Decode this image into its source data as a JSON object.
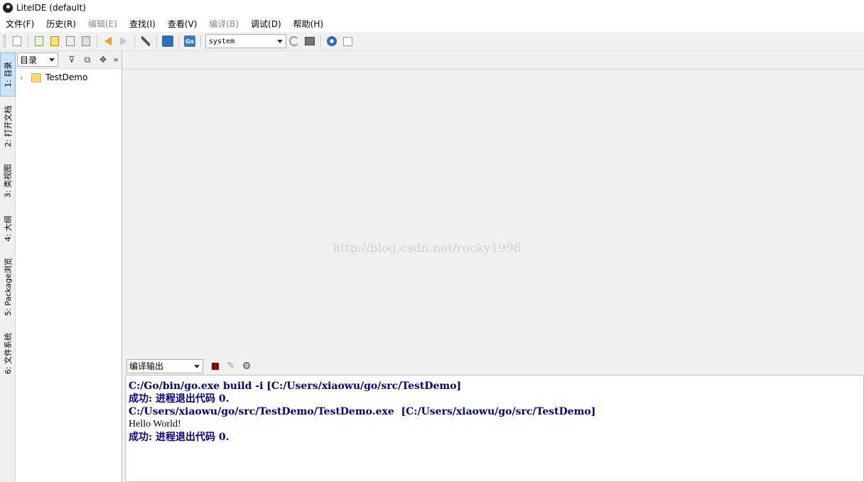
{
  "window": {
    "title": "LiteIDE (default)"
  },
  "menu": [
    {
      "label": "文件(F)",
      "enabled": true
    },
    {
      "label": "历史(R)",
      "enabled": true
    },
    {
      "label": "编辑(E)",
      "enabled": false
    },
    {
      "label": "查找(I)",
      "enabled": true
    },
    {
      "label": "查看(V)",
      "enabled": true
    },
    {
      "label": "编译(B)",
      "enabled": false
    },
    {
      "label": "调试(D)",
      "enabled": true
    },
    {
      "label": "帮助(H)",
      "enabled": true
    }
  ],
  "toolbar": {
    "env_value": "system",
    "icons": [
      "new-file-icon",
      "open-file-icon",
      "save-icon",
      "save-as-icon",
      "save-all-icon",
      "back-arrow-icon",
      "forward-arrow-icon",
      "tools-icon",
      "home-icon",
      "go-icon",
      "refresh-icon",
      "environment-icon",
      "settings-icon",
      "checkbox-icon"
    ]
  },
  "side_tabs": [
    {
      "label": "1: 目录",
      "active": true
    },
    {
      "label": "2: 打开文档",
      "active": false
    },
    {
      "label": "3: 类视图",
      "active": false
    },
    {
      "label": "4: 大纲",
      "active": false
    },
    {
      "label": "5: Package浏览",
      "active": false
    },
    {
      "label": "6: 文件系统",
      "active": false
    }
  ],
  "project_panel": {
    "select_value": "目录",
    "tree": [
      {
        "label": "TestDemo",
        "expanded": false
      }
    ]
  },
  "editor": {
    "watermark": "http://blog.csdn.net/rocky1996"
  },
  "output": {
    "select_value": "编译输出",
    "lines": [
      {
        "text": "C:/Go/bin/go.exe build -i [C:/Users/xiaowu/go/src/TestDemo]",
        "style": "cmd"
      },
      {
        "text": "成功: 进程退出代码 0.",
        "style": "cmd"
      },
      {
        "text": "C:/Users/xiaowu/go/src/TestDemo/TestDemo.exe  [C:/Users/xiaowu/go/src/TestDemo]",
        "style": "cmd"
      },
      {
        "text": "Hello World!",
        "style": "plain"
      },
      {
        "text": "成功: 进程退出代码 0.",
        "style": "cmd"
      }
    ]
  },
  "colors": {
    "output_command": "#00008b",
    "active_tab": "#cde4f7",
    "stop_button": "#8b0000"
  }
}
